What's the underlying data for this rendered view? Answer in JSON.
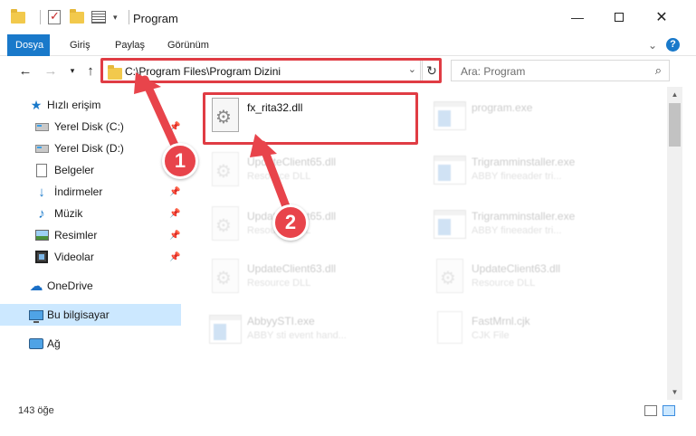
{
  "window": {
    "title": "Program",
    "minimize_icon": "minimize-icon",
    "maximize_icon": "maximize-icon",
    "close_icon": "close-icon"
  },
  "ribbon": {
    "tabs": [
      {
        "label": "Dosya",
        "active": true
      },
      {
        "label": "Giriş"
      },
      {
        "label": "Paylaş"
      },
      {
        "label": "Görünüm"
      }
    ]
  },
  "address": {
    "path": "C:\\Program Files\\Program Dizini",
    "search_placeholder": "Ara: Program"
  },
  "sidebar": {
    "items": [
      {
        "label": "Hızlı erişim",
        "icon": "star-icon"
      },
      {
        "label": "Yerel Disk (C:)",
        "icon": "disk-icon",
        "pinned": true
      },
      {
        "label": "Yerel Disk (D:)",
        "icon": "disk-icon"
      },
      {
        "label": "Belgeler",
        "icon": "document-icon"
      },
      {
        "label": "İndirmeler",
        "icon": "download-icon",
        "pinned": true
      },
      {
        "label": "Müzik",
        "icon": "music-icon",
        "pinned": true
      },
      {
        "label": "Resimler",
        "icon": "pictures-icon",
        "pinned": true
      },
      {
        "label": "Videolar",
        "icon": "videos-icon",
        "pinned": true
      },
      {
        "label": "OneDrive",
        "icon": "cloud-icon"
      },
      {
        "label": "Bu bilgisayar",
        "icon": "computer-icon",
        "selected": true
      },
      {
        "label": "Ağ",
        "icon": "network-icon"
      }
    ]
  },
  "files": [
    {
      "name": "fx_rita32.dll",
      "type": "",
      "icon": "dll-icon",
      "highlighted": true
    },
    {
      "name": "program.exe",
      "type": "",
      "icon": "exe-icon",
      "faded": true
    },
    {
      "name": "UpdateClient65.dll",
      "type": "Resource DLL",
      "icon": "dll-icon",
      "faded": true
    },
    {
      "name": "Trigramminstaller.exe",
      "type": "ABBY fineeader tri...",
      "icon": "exe-icon",
      "faded": true
    },
    {
      "name": "UpdateClient65.dll",
      "type": "Resource DLL",
      "icon": "dll-icon",
      "faded": true
    },
    {
      "name": "Trigramminstaller.exe",
      "type": "ABBY fineeader tri...",
      "icon": "exe-icon",
      "faded": true
    },
    {
      "name": "UpdateClient63.dll",
      "type": "Resource DLL",
      "icon": "dll-icon",
      "faded": true
    },
    {
      "name": "UpdateClient63.dll",
      "type": "Resource DLL",
      "icon": "dll-icon",
      "faded": true
    },
    {
      "name": "AbbyySTI.exe",
      "type": "ABBY sti event hand...",
      "icon": "exe-icon",
      "faded": true
    },
    {
      "name": "FastMrnl.cjk",
      "type": "CJK File",
      "icon": "file-icon",
      "faded": true
    }
  ],
  "status": {
    "item_count": "143 öğe"
  },
  "annotations": {
    "badge1": "1",
    "badge2": "2",
    "accent": "#e8444b"
  }
}
